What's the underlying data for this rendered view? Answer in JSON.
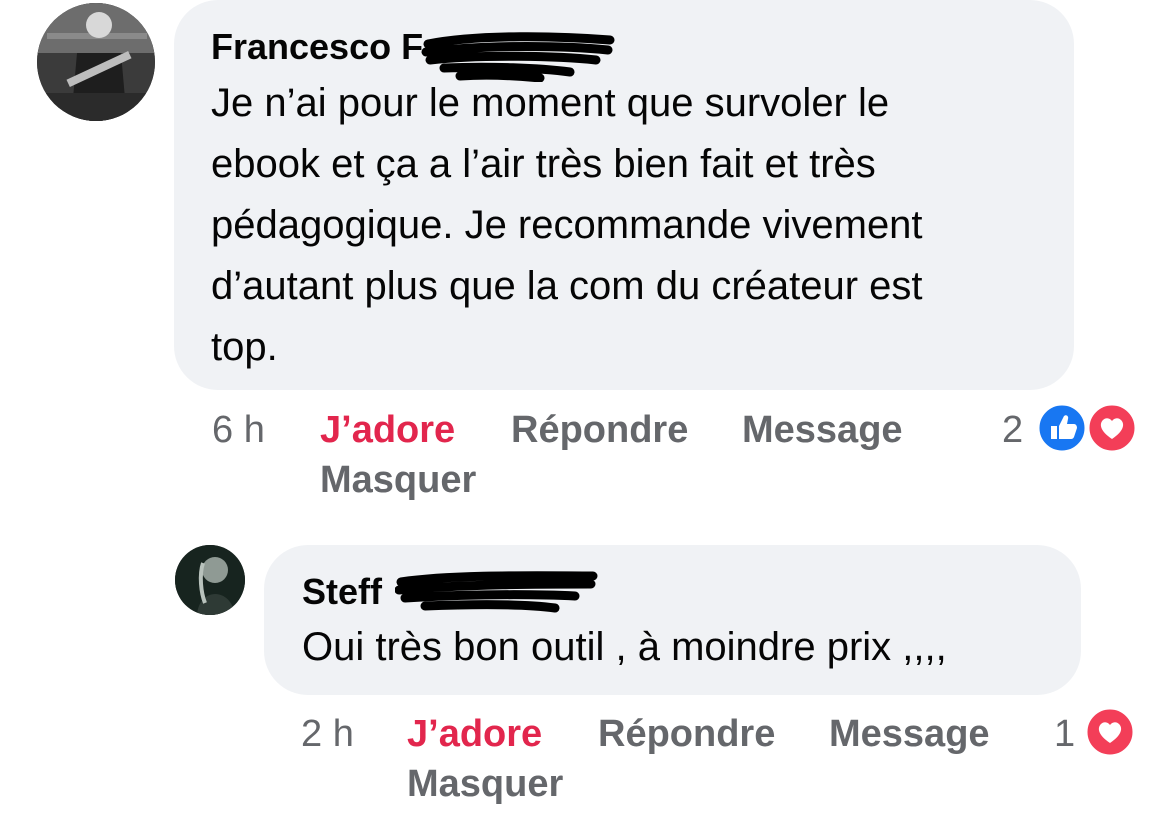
{
  "comments": [
    {
      "author": "Francesco F",
      "text": "Je n’ai pour le moment que survoler le\nebook et ça a l’air très bien fait et très\npédagogique. Je recommande vivement\nd’autant plus que la com du créateur est\ntop.",
      "time": "6 h",
      "love_label": "J’adore",
      "reply_label": "Répondre",
      "message_label": "Message",
      "hide_label": "Masquer",
      "reaction_count": "2",
      "reactions": [
        "like-icon",
        "love-icon"
      ]
    },
    {
      "author": "Steff",
      "text": "Oui très bon outil , à moindre prix ,,,,",
      "time": "2 h",
      "love_label": "J’adore",
      "reply_label": "Répondre",
      "message_label": "Message",
      "hide_label": "Masquer",
      "reaction_count": "1",
      "reactions": [
        "love-icon"
      ]
    }
  ],
  "colors": {
    "bubble": "#f0f2f5",
    "love_red": "#e2264d",
    "like_blue": "#1877f2",
    "meta_gray": "#65676b"
  }
}
